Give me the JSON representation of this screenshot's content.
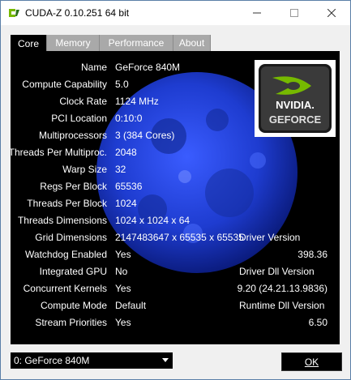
{
  "window": {
    "title": "CUDA-Z 0.10.251 64 bit"
  },
  "tabs": [
    {
      "label": "Core",
      "active": true
    },
    {
      "label": "Memory",
      "active": false
    },
    {
      "label": "Performance",
      "active": false
    },
    {
      "label": "About",
      "active": false
    }
  ],
  "core": {
    "rows": [
      {
        "label": "Name",
        "value": "GeForce 840M"
      },
      {
        "label": "Compute Capability",
        "value": "5.0"
      },
      {
        "label": "Clock Rate",
        "value": "1124 MHz"
      },
      {
        "label": "PCI Location",
        "value": "0:10:0"
      },
      {
        "label": "Multiprocessors",
        "value": "3 (384 Cores)"
      },
      {
        "label": "Threads Per Multiproc.",
        "value": "2048"
      },
      {
        "label": "Warp Size",
        "value": "32"
      },
      {
        "label": "Regs Per Block",
        "value": "65536"
      },
      {
        "label": "Threads Per Block",
        "value": "1024"
      },
      {
        "label": "Threads Dimensions",
        "value": "1024 x 1024 x 64"
      },
      {
        "label": "Grid Dimensions",
        "value": "2147483647 x 65535 x 65535"
      },
      {
        "label": "Watchdog Enabled",
        "value": "Yes"
      },
      {
        "label": "Integrated GPU",
        "value": "No"
      },
      {
        "label": "Concurrent Kernels",
        "value": "Yes"
      },
      {
        "label": "Compute Mode",
        "value": "Default"
      },
      {
        "label": "Stream Priorities",
        "value": "Yes"
      }
    ],
    "driver": {
      "version_label": "Driver Version",
      "version_value": "398.36",
      "dll_label": "Driver Dll Version",
      "dll_value": "9.20 (24.21.13.9836)",
      "runtime_label": "Runtime Dll Version",
      "runtime_value": "6.50"
    },
    "logo": {
      "brand": "NVIDIA",
      "product": "GeForce"
    }
  },
  "footer": {
    "device_selected": "0: GeForce 840M",
    "ok_label": "OK"
  },
  "colors": {
    "panel_bg": "#000000",
    "moon": "#1f3fbf",
    "logo_green": "#76b900"
  },
  "icons": {
    "app": "cuda-z-icon",
    "minimize": "minimize-icon",
    "maximize": "maximize-icon",
    "close": "close-icon"
  }
}
